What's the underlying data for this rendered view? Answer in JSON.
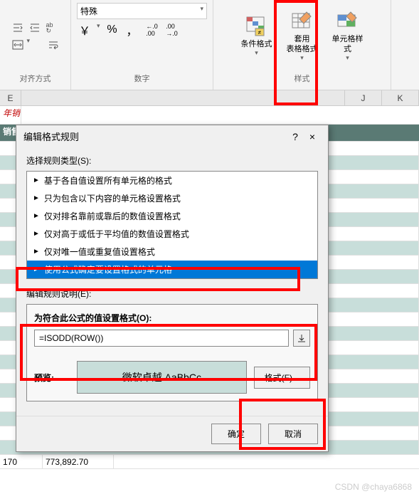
{
  "ribbon": {
    "align_label": "对齐方式",
    "number_label": "数字",
    "number_format": "特殊",
    "styles_label": "样式",
    "conditional_format": "条件格式",
    "table_format": "套用\n表格格式",
    "cell_styles": "单元格样式",
    "percent": "%",
    "comma": "，",
    "currency": "￥",
    "inc_dec": ".00",
    "dec_inc": ".0"
  },
  "sheet": {
    "col_j": "J",
    "col_k": "K",
    "title_fragment": "年销",
    "header_fragment": "销售",
    "bottom_val1": "170",
    "bottom_val2": "773,892.70"
  },
  "dialog": {
    "title": "编辑格式规则",
    "help": "?",
    "close": "×",
    "select_type_label": "选择规则类型(S):",
    "rules": [
      "基于各自值设置所有单元格的格式",
      "只为包含以下内容的单元格设置格式",
      "仅对排名靠前或靠后的数值设置格式",
      "仅对高于或低于平均值的数值设置格式",
      "仅对唯一值或重复值设置格式",
      "使用公式确定要设置格式的单元格"
    ],
    "edit_desc_label": "编辑规则说明(E):",
    "formula_label": "为符合此公式的值设置格式(O):",
    "formula_value": "=ISODD(ROW())",
    "preview_label": "预览:",
    "preview_text": "微软卓越 AaBbCc",
    "format_btn": "格式(F)...",
    "ok": "确定",
    "cancel": "取消"
  },
  "watermark": "CSDN @chaya6868"
}
